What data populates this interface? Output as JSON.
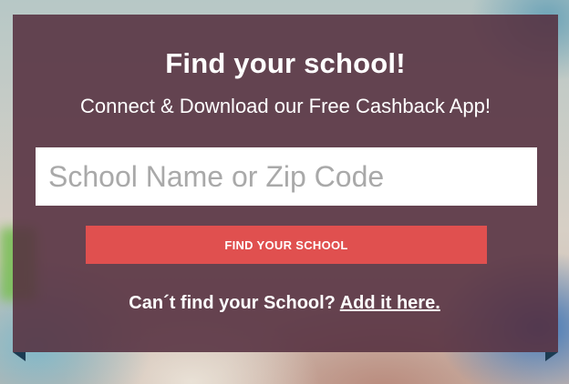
{
  "panel": {
    "title": "Find your school!",
    "subtitle": "Connect & Download our Free Cashback App!",
    "search": {
      "placeholder": "School Name or Zip Code",
      "value": ""
    },
    "find_button_label": "FIND YOUR SCHOOL",
    "add_prompt": "Can´t find your School?",
    "add_link_label": "Add it here."
  },
  "colors": {
    "panel_bg": "#553040",
    "button_bg": "#e0504f",
    "ribbon": "#1b3b52"
  }
}
